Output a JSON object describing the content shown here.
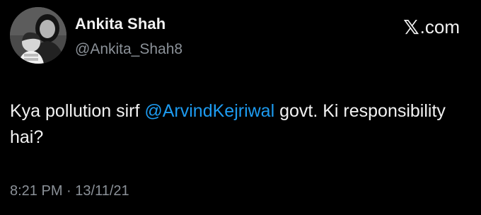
{
  "author": {
    "display_name": "Ankita Shah",
    "handle": "@Ankita_Shah8",
    "avatar_icon": "profile-photo"
  },
  "source": {
    "logo_glyph": "𝕏",
    "domain": ".com"
  },
  "tweet": {
    "text_before": "Kya pollution sirf ",
    "mention": "@ArvindKejriwal",
    "text_after": " govt. Ki responsibility hai?"
  },
  "meta": {
    "time": "8:21 PM",
    "separator": "·",
    "date": "13/11/21"
  },
  "colors": {
    "background": "#000000",
    "text": "#f2f2f2",
    "secondary": "#8b9198",
    "mention": "#1d9bf0"
  }
}
